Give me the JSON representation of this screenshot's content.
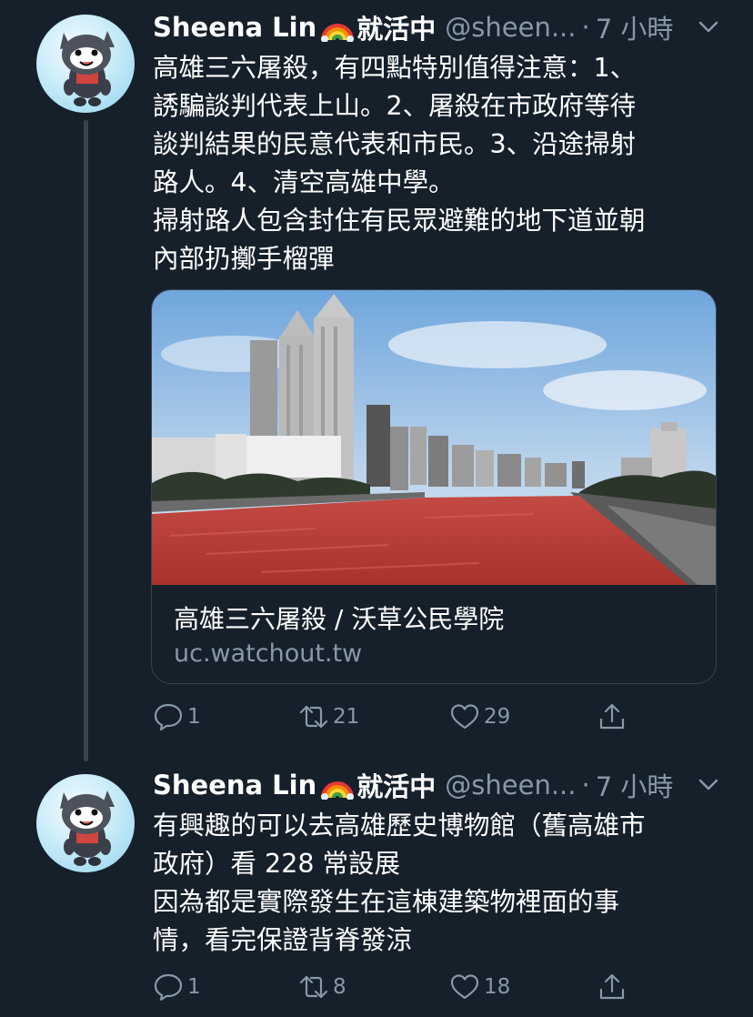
{
  "colors": {
    "background": "#15202b",
    "secondary_text": "#8899a6",
    "border": "#38444d",
    "river_red": "#b23a34"
  },
  "tweets": [
    {
      "author_name": "Sheena Lin",
      "author_emoji": "rainbow",
      "author_status": "就活中",
      "handle": "@sheen...",
      "dot": "·",
      "time": "7 小時",
      "text": "高雄三六屠殺，有四點特別值得注意：1、\n誘騙談判代表上山。2、屠殺在市政府等待\n談判結果的民意代表和市民。3、沿途掃射\n路人。4、清空高雄中學。\n掃射路人包含封住有民眾避難的地下道並朝\n內部扔擲手榴彈",
      "card": {
        "title": "高雄三六屠殺 / 沃草公民學院",
        "domain": "uc.watchout.tw"
      },
      "replies": "1",
      "retweets": "21",
      "likes": "29"
    },
    {
      "author_name": "Sheena Lin",
      "author_emoji": "rainbow",
      "author_status": "就活中",
      "handle": "@sheen...",
      "dot": "·",
      "time": "7 小時",
      "text": "有興趣的可以去高雄歷史博物館（舊高雄市\n政府）看 228 常設展\n因為都是實際發生在這棟建築物裡面的事\n情，看完保證背脊發涼",
      "replies": "1",
      "retweets": "8",
      "likes": "18"
    }
  ]
}
